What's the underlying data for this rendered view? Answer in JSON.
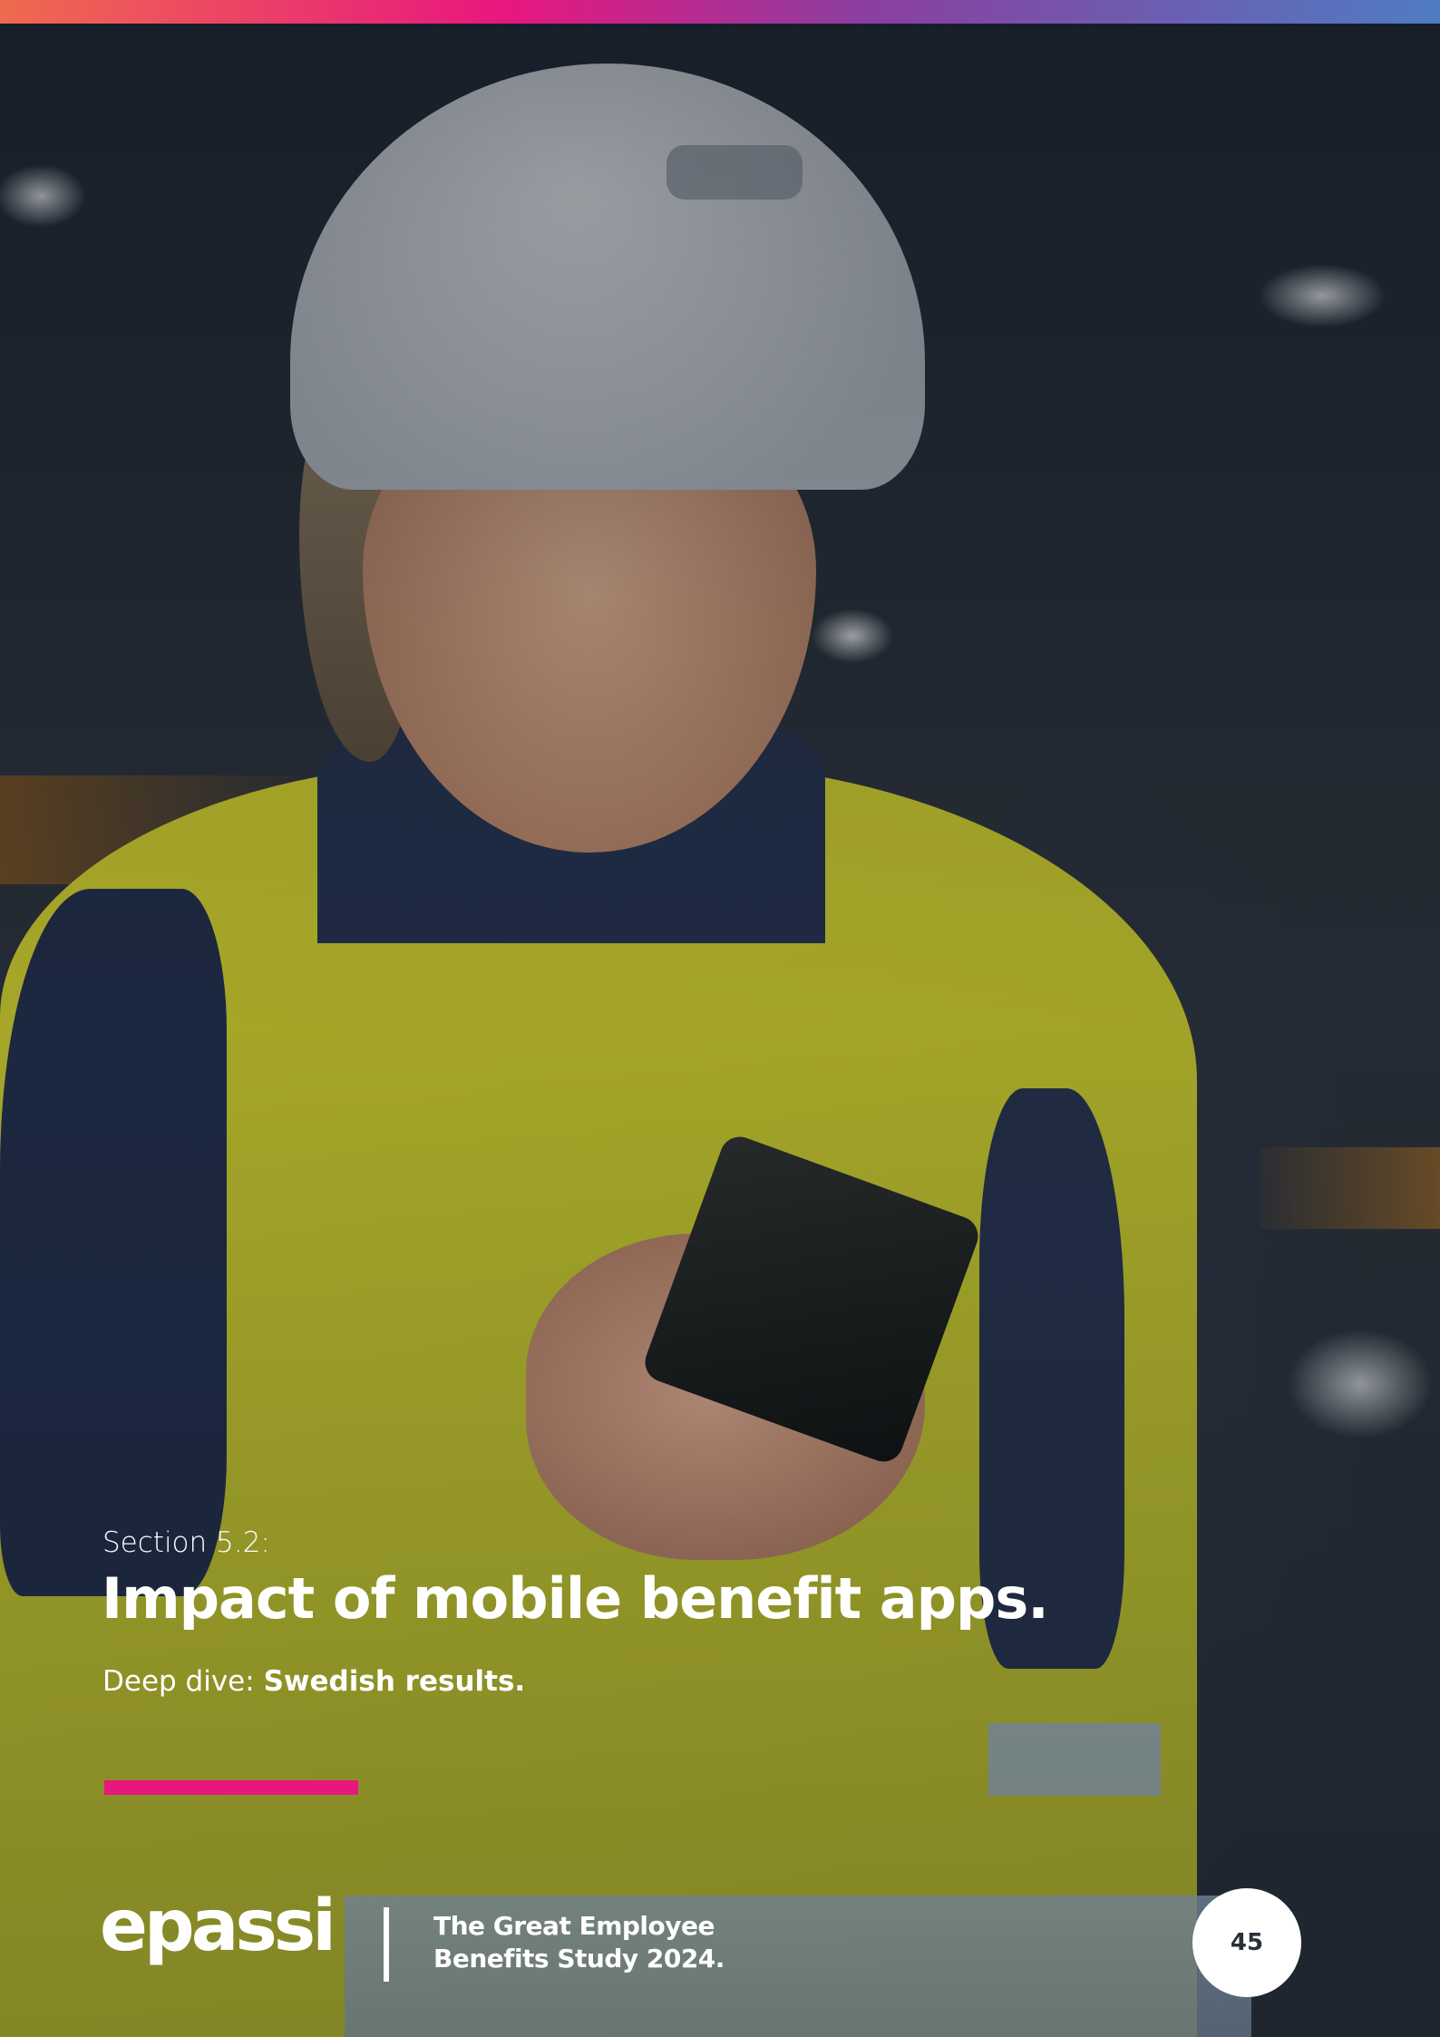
{
  "header": {
    "accent_gradient": [
      "#ef6a4f",
      "#e8177f",
      "#8b3ea0",
      "#4f7cc3"
    ]
  },
  "hero": {
    "section_label": "Section 5.2:",
    "title": "Impact of mobile benefit apps.",
    "subtitle_prefix": "Deep dive: ",
    "subtitle_bold": "Swedish results.",
    "accent_color": "#e8177f"
  },
  "footer": {
    "logo_text": "epassi",
    "study_title_line1": "The Great Employee",
    "study_title_line2": "Benefits Study 2024.",
    "page_number": "45"
  }
}
